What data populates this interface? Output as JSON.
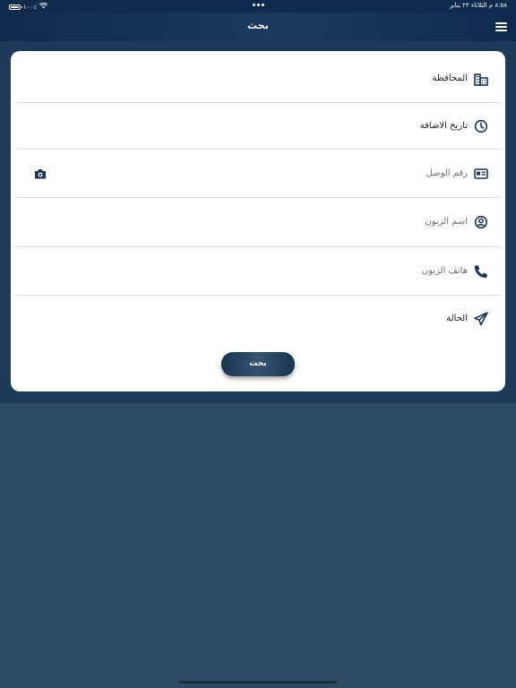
{
  "status_bar": {
    "datetime": "٨:٥٨ م  الثلاثاء ٢٣ يناير",
    "battery": "١٠٠٪"
  },
  "navbar": {
    "title": "بحث",
    "menu_icon": "hamburger-menu-icon"
  },
  "form": {
    "fields": [
      {
        "label": "المحافظة",
        "icon": "city-buildings-icon",
        "filled": true
      },
      {
        "label": "تاريخ الاضافة",
        "icon": "clock-icon",
        "filled": true
      },
      {
        "label": "رقم الوصل",
        "icon": "id-card-icon",
        "filled": false,
        "action_icon": "camera-icon"
      },
      {
        "label": "اسم الزبون",
        "icon": "user-circle-icon",
        "filled": false
      },
      {
        "label": "هاتف الزبون",
        "icon": "phone-icon",
        "filled": false
      },
      {
        "label": "الحالة",
        "icon": "paper-plane-icon",
        "filled": true
      }
    ],
    "submit_label": "بحث"
  },
  "colors": {
    "navbar": "#0f2a4d",
    "background": "#2c4a62",
    "icon": "#1c3550",
    "button": "#2a4660"
  }
}
